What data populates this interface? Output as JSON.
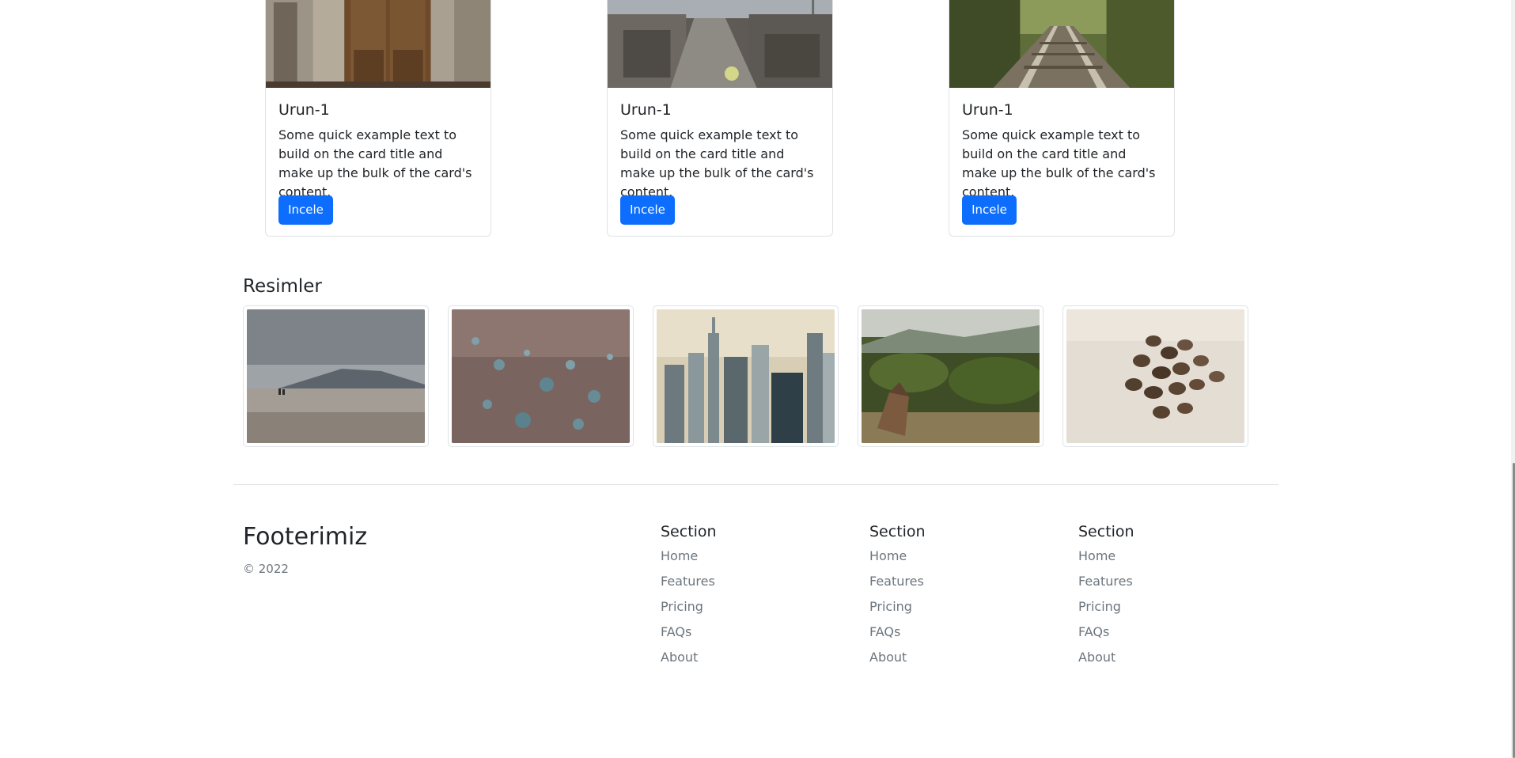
{
  "cards": [
    {
      "title": "Urun-1",
      "text": "Some quick example text to build on the card title and make up the bulk of the card's content.",
      "button": "Incele",
      "image": "wooden-door-photo"
    },
    {
      "title": "Urun-1",
      "text": "Some quick example text to build on the card title and make up the bulk of the card's content.",
      "button": "Incele",
      "image": "city-avenue-photo"
    },
    {
      "title": "Urun-1",
      "text": "Some quick example text to build on the card title and make up the bulk of the card's content.",
      "button": "Incele",
      "image": "railway-tracks-photo"
    }
  ],
  "gallery": {
    "title": "Resimler",
    "images": [
      "beach-photo",
      "water-drops-photo",
      "city-skyline-photo",
      "forest-cabin-photo",
      "coffee-beans-photo"
    ]
  },
  "footer": {
    "brand": "Footerimiz",
    "copyright": "© 2022",
    "sections": [
      {
        "title": "Section",
        "links": [
          "Home",
          "Features",
          "Pricing",
          "FAQs",
          "About"
        ]
      },
      {
        "title": "Section",
        "links": [
          "Home",
          "Features",
          "Pricing",
          "FAQs",
          "About"
        ]
      },
      {
        "title": "Section",
        "links": [
          "Home",
          "Features",
          "Pricing",
          "FAQs",
          "About"
        ]
      }
    ]
  },
  "colors": {
    "primary": "#0d6efd",
    "text": "#212529",
    "muted": "#6c757d",
    "border": "#dee2e6"
  }
}
